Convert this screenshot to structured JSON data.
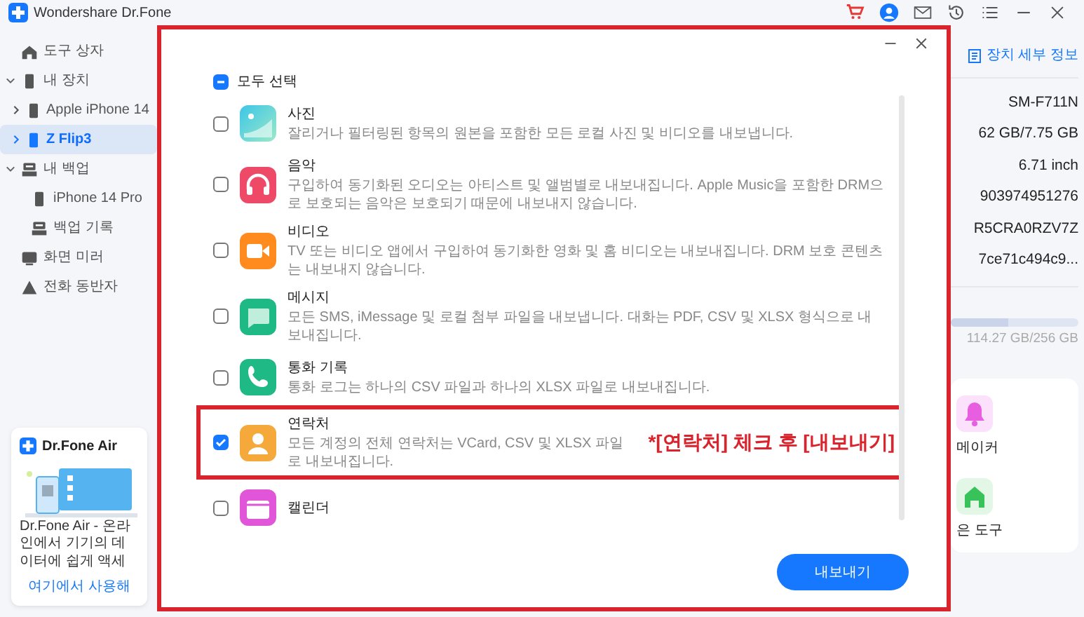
{
  "app": {
    "title": "Wondershare Dr.Fone"
  },
  "toolbar": [
    {
      "kind": "cart"
    },
    {
      "kind": "avatar"
    },
    {
      "kind": "mail"
    },
    {
      "kind": "history"
    },
    {
      "kind": "list"
    },
    {
      "kind": "minimize"
    },
    {
      "kind": "close"
    }
  ],
  "sidebar": {
    "items": [
      {
        "label": "도구 상자",
        "kind": "home",
        "selected": false
      },
      {
        "label": "내 장치",
        "kind": "device",
        "selected": false,
        "expanded": true,
        "children": [
          {
            "label": "Apple iPhone 14",
            "kind": "device",
            "selected": false,
            "expanded": false
          },
          {
            "label": "Z Flip3",
            "kind": "device",
            "selected": true,
            "expanded": false
          }
        ]
      },
      {
        "label": "내 백업",
        "kind": "backup",
        "selected": false,
        "expanded": true,
        "children": [
          {
            "label": "iPhone 14 Pro",
            "kind": "device",
            "selected": false
          },
          {
            "label": "백업 기록",
            "kind": "backup",
            "selected": false
          }
        ]
      },
      {
        "label": "화면 미러",
        "kind": "mirror",
        "selected": false
      },
      {
        "label": "전화 동반자",
        "kind": "companion",
        "selected": false
      }
    ]
  },
  "promo": {
    "title": "Dr.Fone Air",
    "text": "Dr.Fone Air - 온라인에서 기기의 데이터에 쉽게 액세",
    "link": "여기에서 사용해"
  },
  "device_panel": {
    "details_link": "장치 세부 정보",
    "values": [
      "SM-F711N",
      "62 GB/7.75 GB",
      "6.71 inch",
      "903974951276",
      "R5CRA0RZV7Z",
      "7ce71c494c9..."
    ],
    "storage": {
      "level": 0.45,
      "reading": "114.27 GB/256 GB"
    },
    "tools": [
      {
        "label": "메이커",
        "kind": "bell"
      },
      {
        "label": "은 도구",
        "kind": "house"
      }
    ]
  },
  "dialog": {
    "highlighted": true,
    "select_all": {
      "label": "모두 선택",
      "indeterminate": true
    },
    "items": [
      {
        "title": "사진",
        "description": "잘리거나 필터링된 항목의 원본을 포함한 모든 로컬 사진 및 비디오를 내보냅니다.",
        "kind": "photo",
        "checked": false,
        "highlighted": false
      },
      {
        "title": "음악",
        "description": "구입하여 동기화된 오디오는 아티스트 및 앨범별로 내보내집니다. Apple Music을 포함한 DRM으로 보호되는 음악은 보호되기 때문에 내보내지 않습니다.",
        "kind": "music",
        "checked": false,
        "highlighted": false
      },
      {
        "title": "비디오",
        "description": "TV 또는 비디오 앱에서 구입하여 동기화한 영화 및 홈 비디오는 내보내집니다. DRM 보호 콘텐츠는 내보내지 않습니다.",
        "kind": "video",
        "checked": false,
        "highlighted": false
      },
      {
        "title": "메시지",
        "description": "모든 SMS, iMessage 및 로컬 첨부 파일을 내보냅니다. 대화는 PDF, CSV 및 XLSX 형식으로 내보내집니다.",
        "kind": "message",
        "checked": false,
        "highlighted": false
      },
      {
        "title": "통화 기록",
        "description": "통화 로그는 하나의 CSV 파일과 하나의 XLSX 파일로 내보내집니다.",
        "kind": "call",
        "checked": false,
        "highlighted": false
      },
      {
        "title": "연락처",
        "description": "모든 계정의 전체 연락처는 VCard, CSV 및 XLSX 파일로 내보내집니다.",
        "kind": "contact",
        "checked": true,
        "highlighted": true
      },
      {
        "title": "캘린더",
        "kind": "calendar",
        "checked": false,
        "highlighted": false
      }
    ],
    "export_button": "내보내기"
  },
  "annotation": {
    "text": "*[연락처] 체크 후 [내보내기]"
  }
}
